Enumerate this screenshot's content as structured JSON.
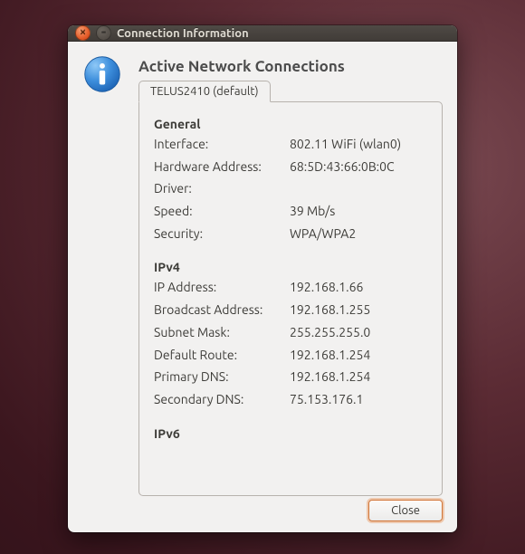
{
  "window": {
    "title": "Connection Information"
  },
  "heading": "Active Network Connections",
  "tab": {
    "label": "TELUS2410 (default)"
  },
  "sections": {
    "general": {
      "title": "General",
      "rows": [
        {
          "label": "Interface:",
          "value": "802.11 WiFi (wlan0)"
        },
        {
          "label": "Hardware Address:",
          "value": "68:5D:43:66:0B:0C"
        },
        {
          "label": "Driver:",
          "value": ""
        },
        {
          "label": "Speed:",
          "value": "39 Mb/s"
        },
        {
          "label": "Security:",
          "value": "WPA/WPA2"
        }
      ]
    },
    "ipv4": {
      "title": "IPv4",
      "rows": [
        {
          "label": "IP Address:",
          "value": "192.168.1.66"
        },
        {
          "label": "Broadcast Address:",
          "value": "192.168.1.255"
        },
        {
          "label": "Subnet Mask:",
          "value": "255.255.255.0"
        },
        {
          "label": "Default Route:",
          "value": "192.168.1.254"
        },
        {
          "label": "Primary DNS:",
          "value": "192.168.1.254"
        },
        {
          "label": "Secondary DNS:",
          "value": "75.153.176.1"
        }
      ]
    },
    "ipv6": {
      "title": "IPv6"
    }
  },
  "buttons": {
    "close": "Close"
  }
}
